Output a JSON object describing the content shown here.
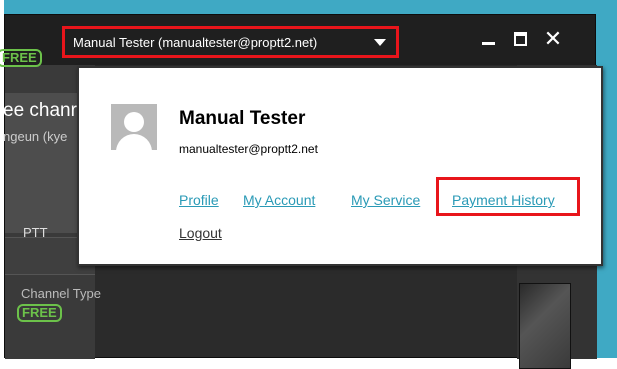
{
  "window": {
    "account_label": "Manual Tester (manualtester@proptt2.net)",
    "minimize_glyph": "",
    "maximize_glyph": "",
    "close_glyph": "✕"
  },
  "background": {
    "free_badge_top": "FREE",
    "channel_title_partial": "ee chanr",
    "channel_user_partial": "ngeun (kye",
    "tab_ptt": "PTT",
    "channel_type_label": "Channel Type",
    "free_badge_bottom": "FREE"
  },
  "popup": {
    "user_name": "Manual Tester",
    "user_email": "manualtester@proptt2.net",
    "links": {
      "profile": "Profile",
      "my_account": "My Account",
      "my_service": "My Service",
      "payment_history": "Payment History",
      "logout": "Logout"
    }
  },
  "colors": {
    "highlight_red": "#e8151b",
    "link_teal": "#2a9ab6",
    "free_green": "#6cc24a",
    "desktop_blue": "#3fa9c4"
  }
}
